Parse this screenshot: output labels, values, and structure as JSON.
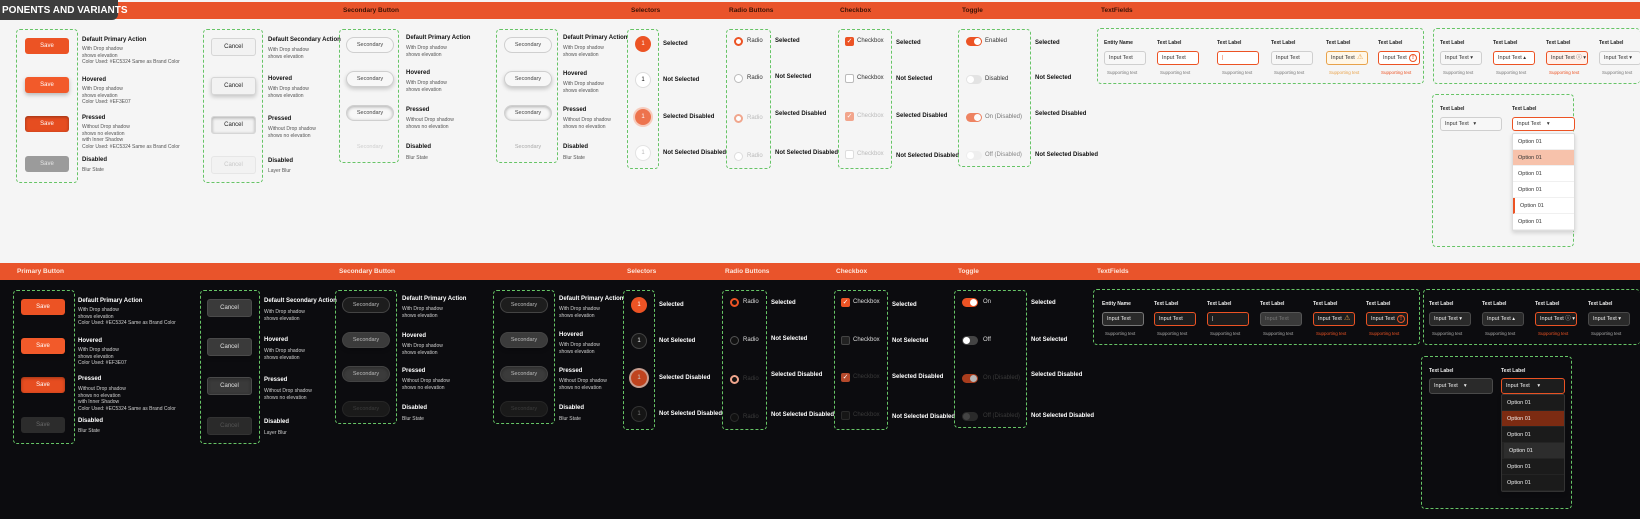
{
  "page_title": "PONENTS AND VARIANTS",
  "sections": {
    "primary": "Primary Button",
    "secondary": "Secondary Button",
    "selectors": "Selectors",
    "radio": "Radio Buttons",
    "checkbox": "Checkbox",
    "toggle": "Toggle",
    "textfields": "TextFields"
  },
  "primary": {
    "button_label": "Save",
    "default": {
      "title": "Default Primary Action",
      "lines": [
        "With Drop shadow",
        "shows elevation",
        "Color Used: #EC5324 Same as Brand Color"
      ]
    },
    "hovered": {
      "title": "Hovered",
      "lines": [
        "With Drop shadow",
        "shows elevation",
        "Color Used: #EF3E07"
      ]
    },
    "pressed": {
      "title": "Pressed",
      "lines": [
        "Without Drop shadow",
        "shows no elevation",
        "with Inner Shadow",
        "Color Used: #EC5324 Same as Brand Color"
      ]
    },
    "disabled": {
      "title": "Disabled",
      "lines": [
        "Blur State"
      ]
    }
  },
  "cancel": {
    "button_label": "Cancel",
    "default": {
      "title": "Default Secondary Action",
      "lines": [
        "With Drop shadow",
        "shows elevation"
      ]
    },
    "hovered": {
      "title": "Hovered",
      "lines": [
        "With Drop shadow",
        "shows elevation"
      ]
    },
    "pressed": {
      "title": "Pressed",
      "lines": [
        "Without Drop shadow",
        "shows no elevation"
      ]
    },
    "disabled": {
      "title": "Disabled",
      "lines": [
        "Layer Blur"
      ]
    }
  },
  "secondary_btn": {
    "button_label": "Secondary",
    "default": {
      "title": "Default Primary Action",
      "lines": [
        "With Drop shadow",
        "shows elevation"
      ]
    },
    "hovered": {
      "title": "Hovered",
      "lines": [
        "With Drop shadow",
        "shows elevation"
      ]
    },
    "pressed": {
      "title": "Pressed",
      "lines": [
        "Without Drop shadow",
        "shows no elevation"
      ]
    },
    "disabled": {
      "title": "Disabled",
      "lines": [
        "Blur State"
      ]
    }
  },
  "selectors": {
    "value": "1",
    "states": [
      "Selected",
      "Not Selected",
      "Selected Disabled",
      "Not Selected Disabled"
    ]
  },
  "radio": {
    "label": "Radio",
    "states": [
      "Selected",
      "Not Selected",
      "Selected Disabled",
      "Not Selected Disabled"
    ]
  },
  "checkbox": {
    "label": "Checkbox",
    "states": [
      "Selected",
      "Not Selected",
      "Selected Disabled",
      "Not Selected Disabled"
    ]
  },
  "toggle": {
    "light_labels": [
      "Enabled",
      "Disabled",
      "On (Disabled)",
      "Off (Disabled)"
    ],
    "dark_labels": [
      "On",
      "Off",
      "On (Disabled)",
      "Off (Disabled)"
    ],
    "states": [
      "Selected",
      "Not Selected",
      "Selected Disabled",
      "Not Selected Disabled"
    ]
  },
  "textfields": {
    "entity_name": "Entity Name",
    "text_label": "Text Label",
    "input_text": "Input Text",
    "supporting": "Supporting text",
    "option": "Option 01"
  },
  "colors": {
    "brand": "#EC5324",
    "hover": "#EF3E07"
  }
}
